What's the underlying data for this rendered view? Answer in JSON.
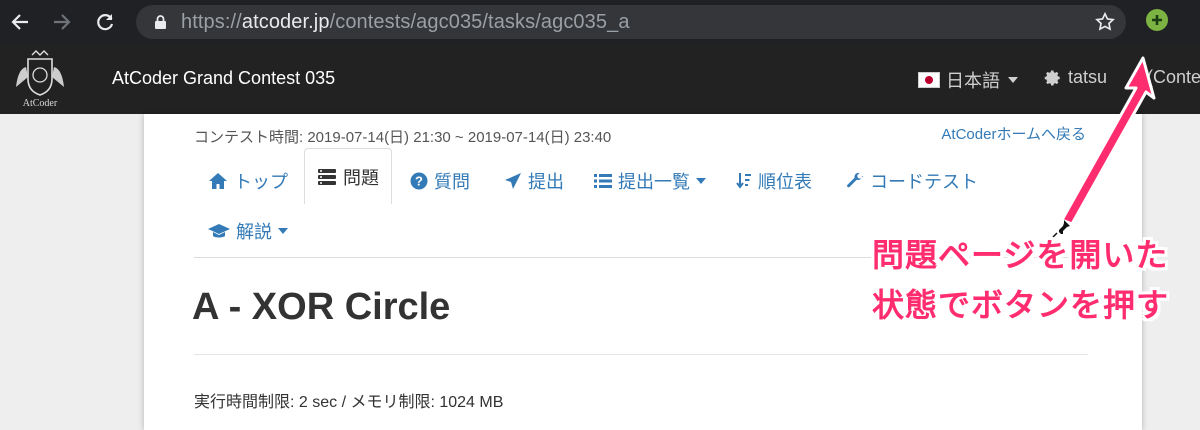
{
  "browser": {
    "url_prefix": "https://",
    "url_host": "atcoder.jp",
    "url_path": "/contests/agc035/tasks/agc035_a",
    "icons": [
      "back-arrow-icon",
      "forward-arrow-icon",
      "reload-icon",
      "lock-icon",
      "star-icon",
      "extension-plus-icon"
    ]
  },
  "navbar": {
    "logo_text": "AtCoder",
    "brand": "AtCoder Grand Contest 035",
    "language": "日本語",
    "user": "tatsu",
    "user_tail": "(Conte",
    "colors": {
      "bg": "#222222"
    }
  },
  "contest": {
    "time": "コンテスト時間: 2019-07-14(日) 21:30 ~ 2019-07-14(日) 23:40",
    "home_link": "AtCoderホームへ戻る"
  },
  "tabs": [
    {
      "label": "トップ",
      "icon": "home-icon"
    },
    {
      "label": "問題",
      "icon": "list-icon",
      "active": true
    },
    {
      "label": "質問",
      "icon": "question-icon"
    },
    {
      "label": "提出",
      "icon": "send-icon"
    },
    {
      "label": "提出一覧",
      "icon": "list-ul-icon",
      "dropdown": true
    },
    {
      "label": "順位表",
      "icon": "sort-icon"
    },
    {
      "label": "コードテスト",
      "icon": "wrench-icon"
    },
    {
      "label": "解説",
      "icon": "graduation-cap-icon",
      "dropdown": true
    }
  ],
  "problem": {
    "title": "A - XOR Circle",
    "limits": "実行時間制限: 2 sec / メモリ制限: 1024 MB"
  },
  "annotation": {
    "line1": "問題ページを開いた",
    "line2": "状態でボタンを押す",
    "color": "#ff2d6f"
  }
}
